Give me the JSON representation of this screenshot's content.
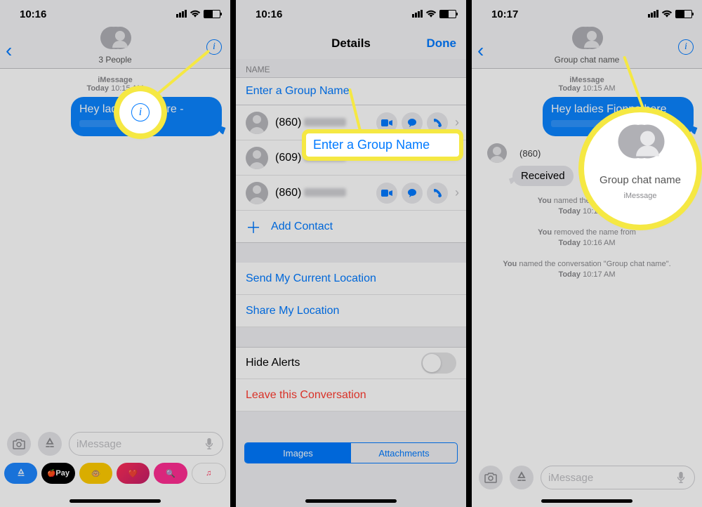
{
  "colors": {
    "accent": "#007aff",
    "bubble": "#0b84ff",
    "highlight": "#f5e843",
    "danger": "#ff3b30"
  },
  "panel1": {
    "time": "10:16",
    "header_sub": "3 People",
    "meta_service": "iMessage",
    "meta_time_prefix": "Today",
    "meta_time": "10:15 AM",
    "bubble_text_pre": "Hey ladi",
    "bubble_text_mid": "na here",
    "bubble_trailing_dash": "-",
    "input_placeholder": "iMessage",
    "app_drawer": [
      "",
      "Pay",
      "",
      "",
      "",
      ""
    ],
    "applepay_label": "Pay"
  },
  "panel2": {
    "time": "10:16",
    "nav_title": "Details",
    "done": "Done",
    "section_name": "NAME",
    "group_name_placeholder": "Enter a Group Name",
    "contacts": [
      {
        "num": "(860)"
      },
      {
        "num": "(609)"
      },
      {
        "num": "(860)"
      }
    ],
    "add_contact": "Add Contact",
    "send_location": "Send My Current Location",
    "share_location": "Share My Location",
    "hide_alerts": "Hide Alerts",
    "leave": "Leave this Conversation",
    "seg_images": "Images",
    "seg_attachments": "Attachments",
    "callout_label": "Enter a Group Name"
  },
  "panel3": {
    "time": "10:17",
    "header_sub": "Group chat name",
    "meta_service": "iMessage",
    "meta_time_prefix": "Today",
    "meta_time": "10:15 AM",
    "bubble_text": "Hey ladies Fionna here",
    "reply_num": "(860)",
    "received_label": "Received",
    "sys1_pre": "You",
    "sys1": " named the conversation",
    "sys1_time_prefix": "Today",
    "sys1_time": "10:16 AM",
    "sys2_pre": "You",
    "sys2": " removed the name from",
    "sys2_time_prefix": "Today",
    "sys2_time": "10:16 AM",
    "sys3_pre": "You",
    "sys3": " named the conversation \"Group chat name\".",
    "sys3_time_prefix": "Today",
    "sys3_time": "10:17 AM",
    "callout_label": "Group chat name",
    "input_placeholder": "iMessage"
  }
}
